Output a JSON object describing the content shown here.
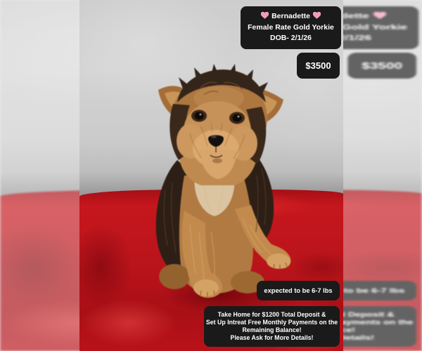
{
  "listing": {
    "name": "Bernadette",
    "name_icon": "pink-heart-icon",
    "breed_line": "Female Rate Gold Yorkie",
    "dob": "DOB- 2/1/26",
    "price": "$3500",
    "weight_note": "expected to be 6-7 lbs",
    "deposit_lines": [
      "Take Home for $1200 Total Deposit &",
      "Set Up Intreat Free Monthly Payments on the",
      "Remaining Balance!",
      "Please Ask for More Details!"
    ]
  },
  "colors": {
    "caption_bg": "#1a1a1a",
    "caption_text": "#ffffff",
    "heart": "#f59ab4"
  }
}
